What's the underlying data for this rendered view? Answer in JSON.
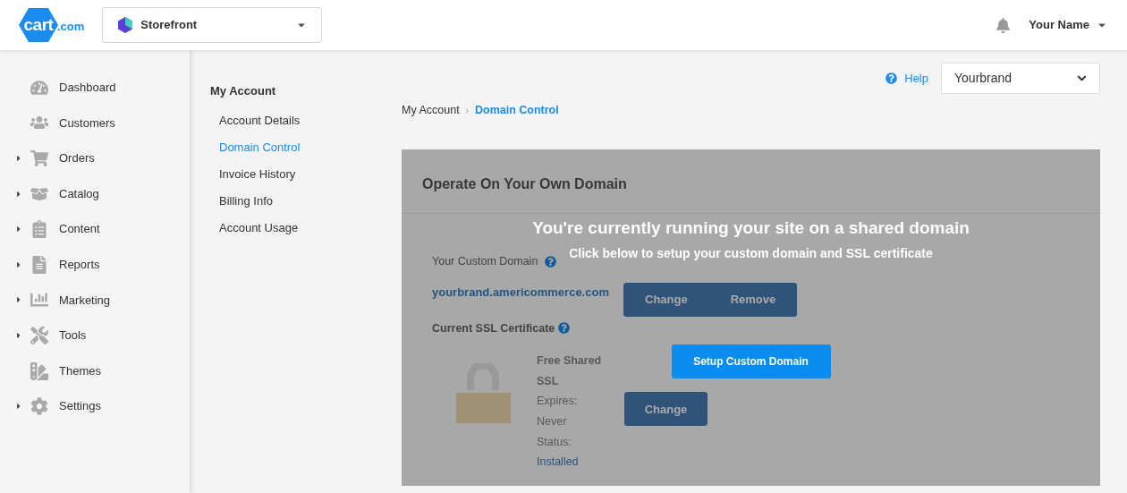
{
  "header": {
    "logo": {
      "main": "cart",
      "suffix": ".com"
    },
    "store_selector": {
      "value": "Storefront"
    },
    "user": {
      "name": "Your Name"
    }
  },
  "sidebar": {
    "items": [
      {
        "label": "Dashboard",
        "expandable": false
      },
      {
        "label": "Customers",
        "expandable": false
      },
      {
        "label": "Orders",
        "expandable": true
      },
      {
        "label": "Catalog",
        "expandable": true
      },
      {
        "label": "Content",
        "expandable": true
      },
      {
        "label": "Reports",
        "expandable": true
      },
      {
        "label": "Marketing",
        "expandable": true
      },
      {
        "label": "Tools",
        "expandable": true
      },
      {
        "label": "Themes",
        "expandable": false
      },
      {
        "label": "Settings",
        "expandable": true
      }
    ]
  },
  "subnav": {
    "title": "My Account",
    "items": [
      {
        "label": "Account Details",
        "selected": false
      },
      {
        "label": "Domain Control",
        "selected": true
      },
      {
        "label": "Invoice History",
        "selected": false
      },
      {
        "label": "Billing Info",
        "selected": false
      },
      {
        "label": "Account Usage",
        "selected": false
      }
    ]
  },
  "toolbar": {
    "help": "Help",
    "brand_select": {
      "value": "Yourbrand"
    }
  },
  "breadcrumb": {
    "separator": "›",
    "items": [
      "My Account",
      "Domain Control"
    ]
  },
  "card": {
    "title": "Operate On Your Own Domain",
    "custom_domain_label": "Your Custom Domain",
    "domain": "yourbrand.americommerce.com",
    "domain_buttons": [
      "Change",
      "Remove"
    ],
    "ssl_label": "Current SSL Certificate",
    "ssl_lines": [
      "Free Shared SSL",
      "Expires:",
      "Never",
      "Status:"
    ],
    "ssl_status": "Installed",
    "ssl_button": "Change"
  },
  "overlay": {
    "heading": "You're currently running your site on a shared domain",
    "subheading": "Click below to setup your custom domain and SSL certificate",
    "button": "Setup Custom Domain"
  }
}
